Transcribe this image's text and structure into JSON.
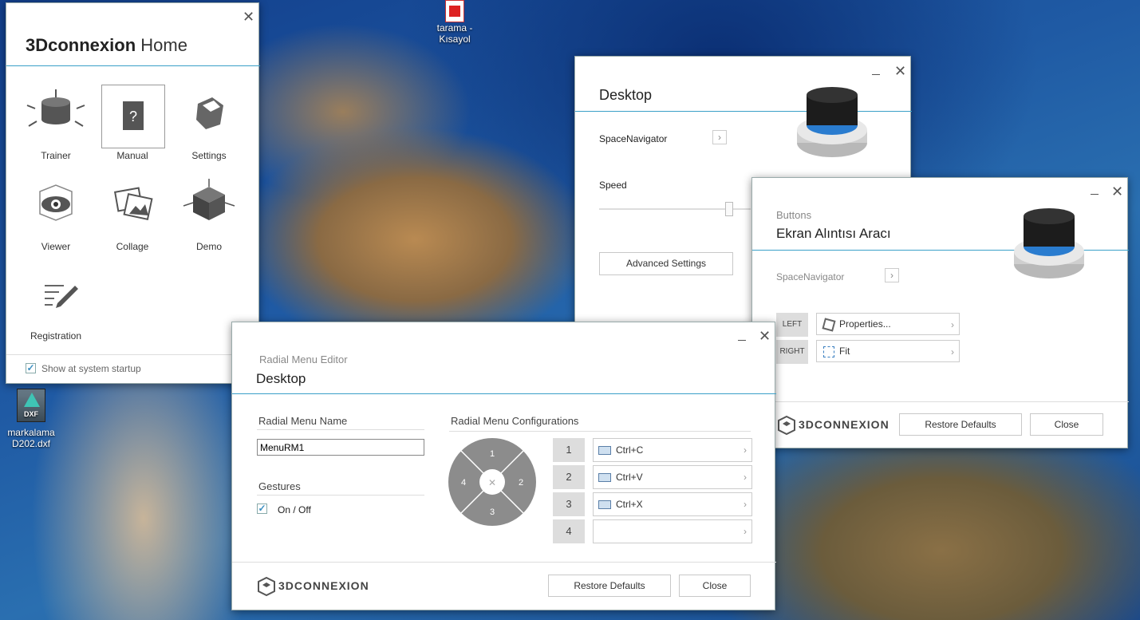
{
  "desktop": {
    "icon_tarama": "tarama - Kısayol",
    "icon_dxf_badge": "DXF",
    "icon_dxf_name": "markalama D202.dxf"
  },
  "home": {
    "title_bold": "3Dconnexion",
    "title_light": "Home",
    "tiles": [
      "Trainer",
      "Manual",
      "Settings",
      "Viewer",
      "Collage",
      "Demo",
      "Registration"
    ],
    "startup_label": "Show at system startup",
    "startup_checked": true
  },
  "desktop_win": {
    "title": "Desktop",
    "device": "SpaceNavigator",
    "speed_label": "Speed",
    "speed_value": 0.86,
    "advanced_label": "Advanced Settings"
  },
  "buttons_win": {
    "subtitle": "Buttons",
    "title": "Ekran Alıntısı Aracı",
    "device": "SpaceNavigator",
    "left_label": "LEFT",
    "left_cmd": "Properties...",
    "right_label": "RIGHT",
    "right_cmd": "Fit",
    "brand": "3DCONNEXION",
    "restore_label": "Restore Defaults",
    "close_label": "Close"
  },
  "radial": {
    "subtitle": "Radial Menu Editor",
    "title": "Desktop",
    "name_heading": "Radial Menu Name",
    "name_value": "MenuRM1",
    "gestures_heading": "Gestures",
    "gestures_label": "On / Off",
    "gestures_checked": true,
    "config_heading": "Radial Menu Configurations",
    "wheel": [
      "1",
      "2",
      "3",
      "4"
    ],
    "slots": [
      {
        "num": "1",
        "cmd": "Ctrl+C"
      },
      {
        "num": "2",
        "cmd": "Ctrl+V"
      },
      {
        "num": "3",
        "cmd": "Ctrl+X"
      },
      {
        "num": "4",
        "cmd": ""
      }
    ],
    "brand": "3DCONNEXION",
    "restore_label": "Restore Defaults",
    "close_label": "Close"
  },
  "colors": {
    "accent": "#3aa0c8",
    "wheel": "#8c8c8c"
  }
}
